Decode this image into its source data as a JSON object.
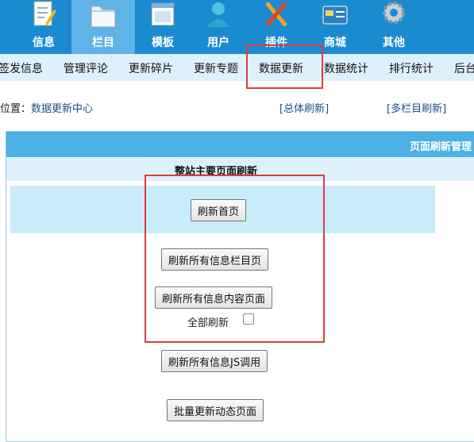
{
  "nav": {
    "items": [
      {
        "label": "信息",
        "icon": "document-pencil-icon"
      },
      {
        "label": "栏目",
        "icon": "folder-icon"
      },
      {
        "label": "模板",
        "icon": "window-template-icon"
      },
      {
        "label": "用户",
        "icon": "user-icon"
      },
      {
        "label": "插件",
        "icon": "tools-icon"
      },
      {
        "label": "商城",
        "icon": "card-icon"
      },
      {
        "label": "其他",
        "icon": "gear-icon"
      }
    ],
    "active": "栏目"
  },
  "submenu": {
    "items": [
      "签发信息",
      "管理评论",
      "更新碎片",
      "更新专题",
      "数据更新",
      "数据统计",
      "排行统计",
      "后台"
    ],
    "active": "数据更新"
  },
  "breadcrumb": {
    "prefix": "位置：",
    "link": "数据更新中心",
    "link_total": "[总体刷新]",
    "link_multi": "[多栏目刷新]"
  },
  "panel": {
    "title": "页面刷新管理",
    "section_title": "整站主要页面刷新",
    "buttons": {
      "home": "刷新首页",
      "columns": "刷新所有信息栏目页",
      "content": "刷新所有信息内容页面",
      "js": "刷新所有信息JS调用",
      "dynamic": "批量更新动态页面"
    },
    "refresh_all_label": "全部刷新"
  },
  "colors": {
    "nav_bg": "#1b8bd0",
    "nav_active": "#5fb3e6",
    "submenu_bg": "#dcf1fc",
    "highlight": "#e23b3b"
  }
}
